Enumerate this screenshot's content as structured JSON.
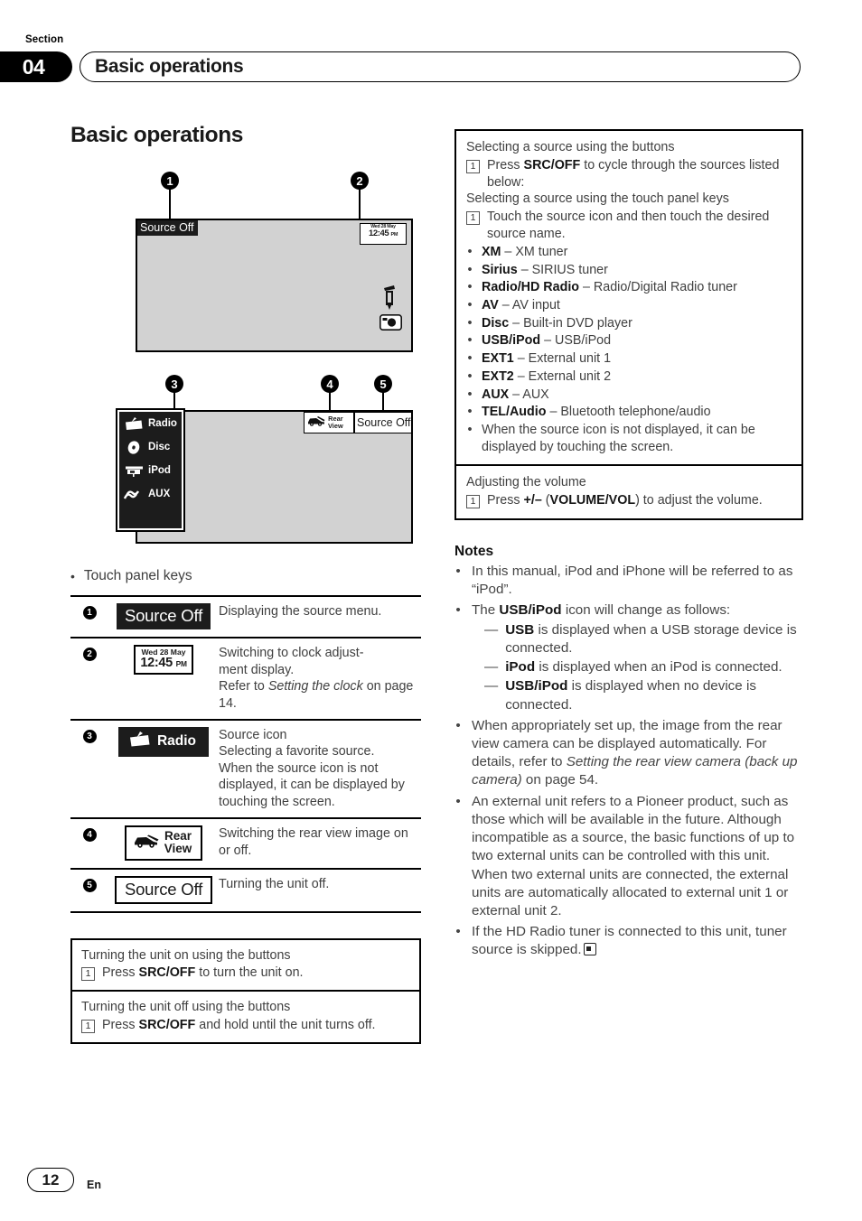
{
  "header": {
    "section_label": "Section",
    "section_number": "04",
    "section_title": "Basic operations"
  },
  "page_title": "Basic operations",
  "figure1": {
    "callouts": [
      "1",
      "2"
    ],
    "source_off_chip": "Source Off",
    "clock_date": "Wed 28 May",
    "clock_time": "12:45",
    "clock_meridiem": "PM",
    "icons": [
      "eject-icon",
      "rear-camera-icon"
    ]
  },
  "figure2": {
    "callouts": [
      "3",
      "4",
      "5"
    ],
    "source_menu": [
      {
        "icon": "radio-icon",
        "label": "Radio"
      },
      {
        "icon": "disc-icon",
        "label": "Disc"
      },
      {
        "icon": "ipod-icon",
        "label": "iPod"
      },
      {
        "icon": "aux-icon",
        "label": "AUX"
      }
    ],
    "rear_view_line1": "Rear",
    "rear_view_line2": "View",
    "source_off_chip": "Source Off"
  },
  "touch_panel": {
    "heading": "Touch panel keys",
    "bullet": "•",
    "rows": [
      {
        "num": "❶",
        "key_type": "source-off-dark",
        "key_label": "Source Off",
        "desc": "Displaying the source menu."
      },
      {
        "num": "❷",
        "key_type": "clock",
        "clock_date": "Wed 28 May",
        "clock_time": "12:45",
        "clock_meridiem": "PM",
        "desc_line1": "Switching to clock adjust-",
        "desc_line2": "ment display.",
        "desc_line3_pre": "Refer to ",
        "desc_line3_em": "Setting the clock",
        "desc_line3_post": " on page 14."
      },
      {
        "num": "❸",
        "key_type": "radio-dark",
        "key_label": "Radio",
        "desc_line1": "Source icon",
        "desc_line2": "Selecting a favorite source.",
        "desc_line3": "When the source icon is not displayed, it can be displayed by touching the screen."
      },
      {
        "num": "❹",
        "key_type": "rear-view",
        "key_label_line1": "Rear",
        "key_label_line2": "View",
        "desc": "Switching the rear view image on or off."
      },
      {
        "num": "❺",
        "key_type": "source-off-light",
        "key_label": "Source Off",
        "desc": "Turning the unit off."
      }
    ]
  },
  "left_boxes": [
    {
      "title": "Turning the unit on using the buttons",
      "step_num": "1",
      "step_pre": "Press ",
      "step_bold": "SRC/OFF",
      "step_post": " to turn the unit on."
    },
    {
      "title": "Turning the unit off using the buttons",
      "step_num": "1",
      "step_pre": "Press ",
      "step_bold": "SRC/OFF",
      "step_post": " and hold until the unit turns off."
    }
  ],
  "right_box_source": {
    "title1": "Selecting a source using the buttons",
    "step1_num": "1",
    "step1_pre": "Press ",
    "step1_bold": "SRC/OFF",
    "step1_post": " to cycle through the sources listed below:",
    "title2": "Selecting a source using the touch panel keys",
    "step2_num": "1",
    "step2_text": "Touch the source icon and then touch the desired source name.",
    "bullet": "•",
    "sources": [
      {
        "name": "XM",
        "desc": " – XM tuner"
      },
      {
        "name": "Sirius",
        "desc": " – SIRIUS tuner"
      },
      {
        "name": "Radio/HD Radio",
        "desc": " – Radio/Digital Radio tuner"
      },
      {
        "name": "AV",
        "desc": " – AV input"
      },
      {
        "name": "Disc",
        "desc": " – Built-in DVD player"
      },
      {
        "name": "USB/iPod",
        "desc": " – USB/iPod"
      },
      {
        "name": "EXT1",
        "desc": " – External unit 1"
      },
      {
        "name": "EXT2",
        "desc": " – External unit 2"
      },
      {
        "name": "AUX",
        "desc": " – AUX"
      },
      {
        "name": "TEL/Audio",
        "desc": " – Bluetooth telephone/audio"
      },
      {
        "name": "",
        "desc": "When the source icon is not displayed, it can be displayed by touching the screen."
      }
    ]
  },
  "right_box_volume": {
    "title": "Adjusting the volume",
    "step_num": "1",
    "step_pre": "Press ",
    "step_bold1": "+/–",
    "step_mid": " (",
    "step_bold2": "VOLUME/VOL",
    "step_post": ") to adjust the volume."
  },
  "notes": {
    "heading": "Notes",
    "bullet": "•",
    "dash": "—",
    "items": [
      {
        "text": "In this manual, iPod and iPhone will be referred to as “iPod”."
      },
      {
        "text_pre": "The ",
        "text_bold": "USB/iPod",
        "text_post": " icon will change as follows:",
        "sub": [
          {
            "bold": "USB",
            "text": " is displayed when a USB storage device is connected."
          },
          {
            "bold": "iPod",
            "text": " is displayed when an iPod is connected."
          },
          {
            "bold": "USB/iPod",
            "text": " is displayed when no device is connected."
          }
        ]
      },
      {
        "text_pre": "When appropriately set up, the image from the rear view camera can be displayed automatically. For details, refer to ",
        "text_em": "Setting the rear view camera (back up camera)",
        "text_post": " on page 54."
      },
      {
        "text": "An external unit refers to a Pioneer product, such as those which will be available in the future. Although incompatible as a source, the basic functions of up to two external units can be controlled with this unit. When two external units are connected, the external units are automatically allocated to external unit 1 or external unit 2."
      },
      {
        "text": "If the HD Radio tuner is connected to this unit, tuner source is skipped.",
        "endmark": true
      }
    ]
  },
  "footer": {
    "page_number": "12",
    "language": "En"
  },
  "colors": {
    "ink": "#1a1a1a",
    "body_text": "#404040",
    "screen_bg": "#d2d2d2",
    "chip_dark": "#1c1c1c"
  }
}
